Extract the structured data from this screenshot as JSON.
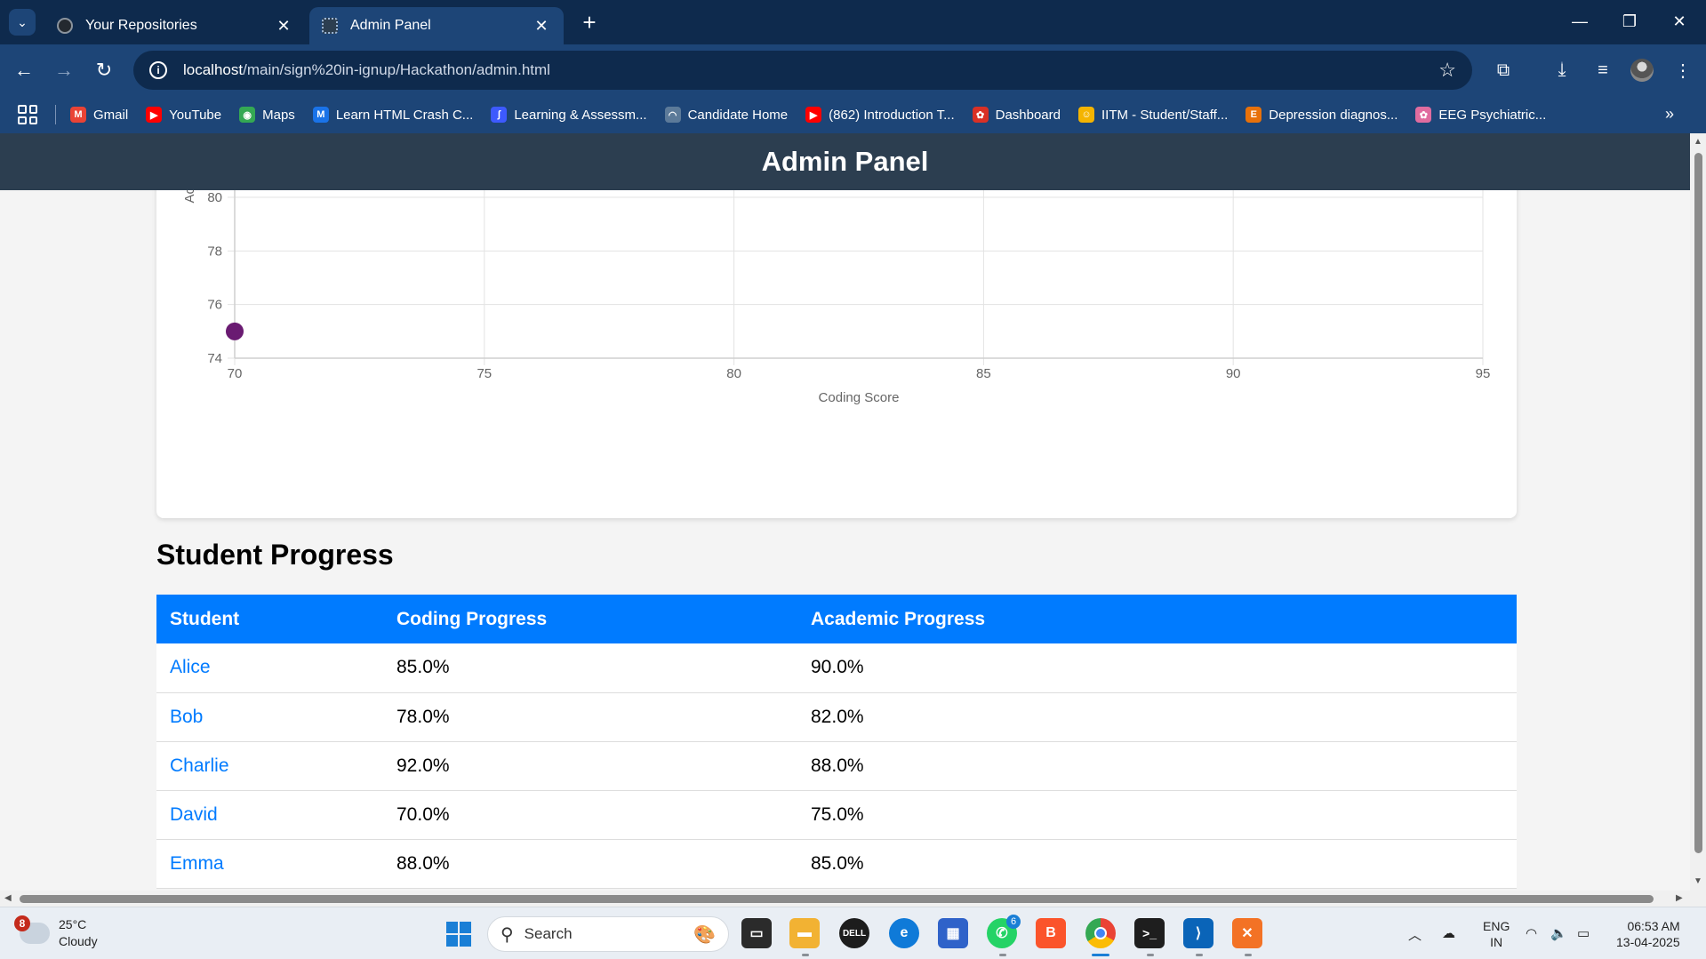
{
  "browser": {
    "tabs": [
      {
        "title": "Your Repositories",
        "favicon_color": "#24292f"
      },
      {
        "title": "Admin Panel",
        "favicon_color": "#2c3e50"
      }
    ],
    "url_host": "localhost",
    "url_path": "/main/sign%20in-ignup/Hackathon/admin.html",
    "bookmarks": [
      {
        "label": "Gmail",
        "icon": "gmail-icon",
        "color": "#ea4335"
      },
      {
        "label": "YouTube",
        "icon": "youtube-icon",
        "color": "#ff0000"
      },
      {
        "label": "Maps",
        "icon": "maps-icon",
        "color": "#34a853"
      },
      {
        "label": "Learn HTML Crash C...",
        "icon": "m-icon",
        "color": "#1a73e8"
      },
      {
        "label": "Learning & Assessm...",
        "icon": "learning-icon",
        "color": "#3d5afe"
      },
      {
        "label": "Candidate Home",
        "icon": "candidate-icon",
        "color": "#5c7a99"
      },
      {
        "label": "(862) Introduction T...",
        "icon": "youtube-icon",
        "color": "#ff0000"
      },
      {
        "label": "Dashboard",
        "icon": "dashboard-icon",
        "color": "#d93025"
      },
      {
        "label": "IITM - Student/Staff...",
        "icon": "iitm-icon",
        "color": "#f4b400"
      },
      {
        "label": "Depression diagnos...",
        "icon": "e-icon",
        "color": "#e8710a"
      },
      {
        "label": "EEG Psychiatric...",
        "icon": "brain-icon",
        "color": "#e06c9f"
      }
    ]
  },
  "page": {
    "header_title": "Admin Panel",
    "section_title": "Student Progress",
    "table": {
      "headers": [
        "Student",
        "Coding Progress",
        "Academic Progress"
      ],
      "rows": [
        {
          "student": "Alice",
          "coding": "85.0%",
          "academic": "90.0%"
        },
        {
          "student": "Bob",
          "coding": "78.0%",
          "academic": "82.0%"
        },
        {
          "student": "Charlie",
          "coding": "92.0%",
          "academic": "88.0%"
        },
        {
          "student": "David",
          "coding": "70.0%",
          "academic": "75.0%"
        },
        {
          "student": "Emma",
          "coding": "88.0%",
          "academic": "85.0%"
        }
      ]
    }
  },
  "chart_data": {
    "type": "scatter",
    "xlabel": "Coding Score",
    "ylabel": "Acade",
    "xlim": [
      70,
      95
    ],
    "ylim": [
      74,
      80
    ],
    "x_ticks": [
      70,
      75,
      80,
      85,
      90,
      95
    ],
    "y_ticks": [
      74,
      76,
      78,
      80
    ],
    "points_visible": [
      {
        "x": 70,
        "y": 75
      }
    ],
    "point_color": "#6a1b72",
    "grid": true
  },
  "taskbar": {
    "weather_temp": "25°C",
    "weather_desc": "Cloudy",
    "weather_badge": "8",
    "search_placeholder": "Search",
    "whatsapp_badge": "6",
    "lang_line1": "ENG",
    "lang_line2": "IN",
    "time": "06:53 AM",
    "date": "13-04-2025"
  }
}
